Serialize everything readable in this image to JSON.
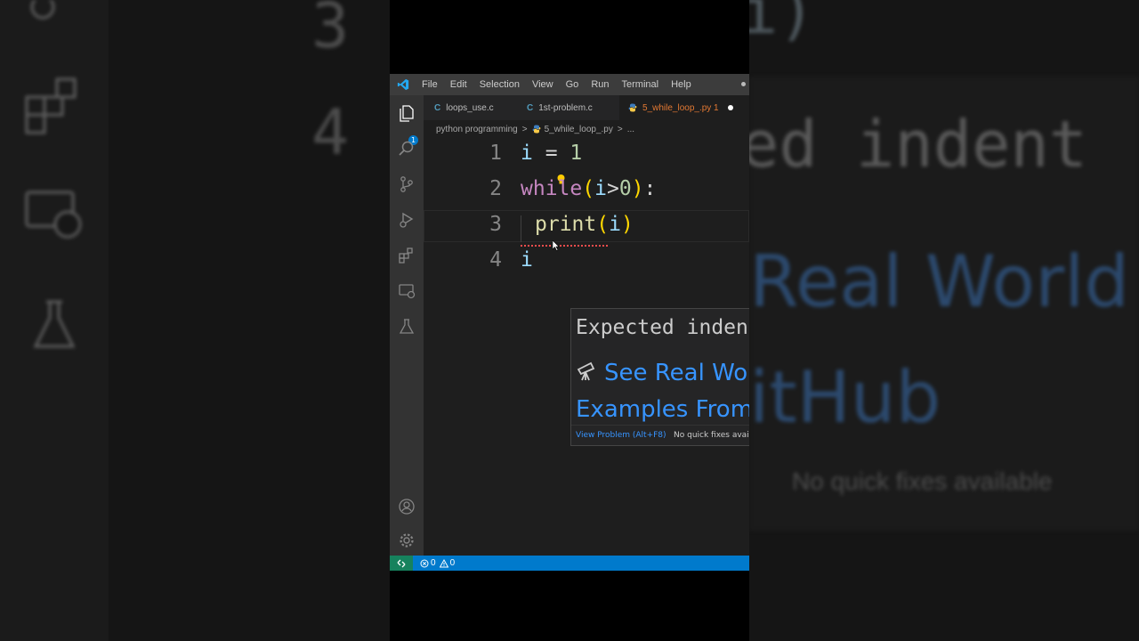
{
  "window": {
    "menu": [
      "File",
      "Edit",
      "Selection",
      "View",
      "Go",
      "Run",
      "Terminal",
      "Help"
    ]
  },
  "tabs": [
    {
      "icon": "C",
      "label": "loops_use.c",
      "active": false
    },
    {
      "icon": "C",
      "label": "1st-problem.c",
      "active": false
    },
    {
      "icon": "python-icon",
      "label": "5_while_loop_.py 1",
      "active": true,
      "modified": true
    }
  ],
  "breadcrumb": {
    "folder": "python programming",
    "sep1": ">",
    "file": "5_while_loop_.py",
    "sep2": ">",
    "more": "..."
  },
  "editor": {
    "line_numbers": [
      "1",
      "2",
      "3",
      "4"
    ],
    "line1": {
      "a": "i",
      "b": " = ",
      "c": "1"
    },
    "line2": {
      "kw": "while",
      "p1": "(",
      "v": "i",
      "op": ">",
      "num": "0",
      "p2": ")",
      "colon": ":"
    },
    "line3": {
      "fn": "print",
      "p1": "(",
      "v": "i",
      "p2": ")"
    },
    "line4": {
      "v": "i"
    }
  },
  "hover": {
    "message": "Expected indent",
    "link": "See Real World Examples From GitHub",
    "view_problem": "View Problem (Alt+F8)",
    "quick_fix": "No quick fixes available"
  },
  "activity_bar": {
    "explorer_badge": "1"
  },
  "status": {
    "errors": "0",
    "warnings": "0"
  },
  "background": {
    "left_line3": "3",
    "left_line4": "4",
    "right_top": "i)",
    "right_msg": "ed indent",
    "right_link1": "Real World",
    "right_link2": "itHub",
    "right_footer": "No quick fixes available"
  },
  "colors": {
    "accent": "#007acc",
    "link": "#3794ff",
    "modified_tab": "#e37933"
  }
}
